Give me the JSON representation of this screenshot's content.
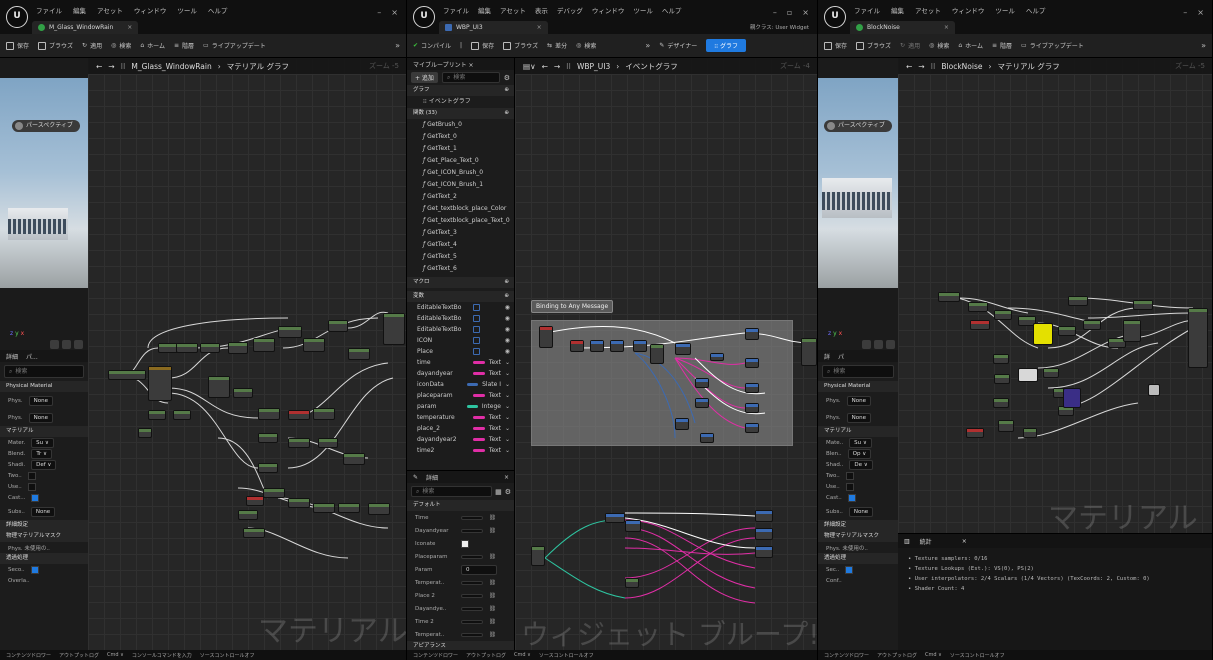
{
  "colors": {
    "accent": "#1f7ae0",
    "bp_blue": "#3c6ab2",
    "text_pink": "#e02ea6",
    "int_teal": "#2ec4a0",
    "exec_white": "#ffffff"
  },
  "win1": {
    "menus": [
      "ファイル",
      "編集",
      "アセット",
      "ウィンドウ",
      "ツール",
      "ヘルプ"
    ],
    "tab_title": "M_Glass_WindowRain",
    "toolbar": [
      "保存",
      "ブラウズ",
      "適用",
      "検索",
      "ホーム",
      "階層",
      "ライブアップデート"
    ],
    "perspective": "パースペクティブ",
    "breadcrumb_asset": "M_Glass_WindowRain",
    "breadcrumb_graph": "マテリアル グラフ",
    "zoom": "ズーム -5",
    "watermark": "マテリアル",
    "details_tabs": [
      "詳細",
      "パ..."
    ],
    "search_placeholder": "検索",
    "physical_material": "Physical Material",
    "phys_rows": [
      {
        "label": "Phys.",
        "value": "None"
      },
      {
        "label": "Phys.",
        "value": "None"
      }
    ],
    "material_section": "マテリアル",
    "mat_rows": [
      {
        "label": "Mater.",
        "value": "Su ∨"
      },
      {
        "label": "Blend.",
        "value": "Tr ∨"
      },
      {
        "label": "Shadi.",
        "value": "Def ∨"
      },
      {
        "label": "Two..",
        "value": ""
      },
      {
        "label": "Use..",
        "value": ""
      },
      {
        "label": "Cast...",
        "value": ""
      },
      {
        "label": "Subs..",
        "value": "None"
      }
    ],
    "sections_after": [
      "詳細設定",
      "物理マテリアルマスク",
      "Phys.  未使用の..",
      "透過処理"
    ],
    "lower_rows": [
      "Seco..",
      "Overla.."
    ],
    "bottom": [
      "コンテンツドロワー",
      "アウトプットログ",
      "Cmd ∨",
      "コンソールコマンドを入力",
      "ソースコントロールオフ"
    ]
  },
  "win2": {
    "menus": [
      "ファイル",
      "編集",
      "アセット",
      "表示",
      "デバッグ",
      "ウィンドウ",
      "ツール",
      "ヘルプ"
    ],
    "tab_title": "WBP_UI3",
    "parent_class": "親クラス: User Widget",
    "toolbar": [
      "コンパイル",
      "保存",
      "ブラウズ",
      "差分",
      "検索"
    ],
    "designer": "デザイナー",
    "graph": "グラフ",
    "my_blueprint": "マイブループリント ×",
    "add_button": "+ 追加",
    "search_placeholder": "検索",
    "graphs_section": "グラフ",
    "event_graph": "イベントグラフ",
    "functions_section": "関数 (33)",
    "functions": [
      "GetBrush_0",
      "GetText_0",
      "GetText_1",
      "Get_Place_Text_0",
      "Get_ICON_Brush_0",
      "Get_ICON_Brush_1",
      "GetText_2",
      "Get_textblock_place_Color",
      "Get_textblock_place_Text_0",
      "GetText_3",
      "GetText_4",
      "GetText_5",
      "GetText_6"
    ],
    "macros_section": "マクロ",
    "variables_section": "変数",
    "variables": [
      {
        "name": "EditableTextBo",
        "type": "",
        "kind": "widget"
      },
      {
        "name": "EditableTextBo",
        "type": "",
        "kind": "widget"
      },
      {
        "name": "EditableTextBo",
        "type": "",
        "kind": "widget"
      },
      {
        "name": "ICON",
        "type": "",
        "kind": "widget"
      },
      {
        "name": "Place",
        "type": "",
        "kind": "widget"
      },
      {
        "name": "time",
        "type": "Text",
        "kind": "text"
      },
      {
        "name": "dayandyear",
        "type": "Text",
        "kind": "text"
      },
      {
        "name": "iconData",
        "type": "Slate I",
        "kind": "struct"
      },
      {
        "name": "placeparam",
        "type": "Text",
        "kind": "text"
      },
      {
        "name": "param",
        "type": "Intege",
        "kind": "int"
      },
      {
        "name": "temperature",
        "type": "Text",
        "kind": "text"
      },
      {
        "name": "place_2",
        "type": "Text",
        "kind": "text"
      },
      {
        "name": "dayandyear2",
        "type": "Text",
        "kind": "text"
      },
      {
        "name": "time2",
        "type": "Text",
        "kind": "text"
      }
    ],
    "details_tab": "詳細",
    "details_search": "検索",
    "default_section": "デフォルト",
    "detail_rows": [
      "Time",
      "Dayandyear",
      "Iconate",
      "Placeparam",
      "Param",
      "Temperat..",
      "Place 2",
      "Dayandye..",
      "Time 2",
      "Temperat.."
    ],
    "param_value": "0",
    "appearance_section": "アピアランス",
    "breadcrumb_asset": "WBP_UI3",
    "breadcrumb_graph": "イベントグラフ",
    "zoom": "ズーム -4",
    "tooltip": "Binding to Any Message",
    "watermark": "ウィジェット ブループ!",
    "bottom": [
      "コンテンツドロワー",
      "アウトプットログ",
      "Cmd ∨",
      "ソースコントロールオフ"
    ]
  },
  "win3": {
    "menus": [
      "ファイル",
      "編集",
      "アセット",
      "ウィンドウ",
      "ツール",
      "ヘルプ"
    ],
    "tab_title": "BlockNoise",
    "toolbar": [
      "保存",
      "ブラウズ",
      "適用",
      "検索",
      "ホーム",
      "階層",
      "ライブアップデート"
    ],
    "perspective": "パースペクティブ",
    "breadcrumb_asset": "BlockNoise",
    "breadcrumb_graph": "マテリアル グラフ",
    "zoom": "ズーム -5",
    "watermark": "マテリアル",
    "details_tabs": [
      "詳",
      "パ"
    ],
    "search_placeholder": "検索",
    "physical_material": "Physical Material",
    "phys_rows": [
      {
        "label": "Phys.",
        "value": "None"
      },
      {
        "label": "Phys.",
        "value": "None"
      }
    ],
    "material_section": "マテリアル",
    "mat_rows": [
      {
        "label": "Mate..",
        "value": "Su ∨"
      },
      {
        "label": "Blen..",
        "value": "Op ∨"
      },
      {
        "label": "Shad..",
        "value": "De ∨"
      },
      {
        "label": "Two..",
        "value": ""
      },
      {
        "label": "Use..",
        "value": ""
      },
      {
        "label": "Cast..",
        "value": ""
      },
      {
        "label": "Subs..",
        "value": "None"
      }
    ],
    "sections_after": [
      "詳細設定",
      "物理マテリアルマスク",
      "Phys.  未使用の..",
      "透過処理"
    ],
    "lower_rows": [
      "Sec..",
      "Conf.."
    ],
    "stats_tab": "統計",
    "stats": [
      "• Texture samplers: 0/16",
      "• Texture Lookups (Est.): VS(0), PS(2)",
      "• User interpolators: 2/4 Scalars (1/4 Vectors) (TexCoords: 2, Custom: 0)",
      "• Shader Count: 4"
    ],
    "bottom": [
      "コンテンツドロワー",
      "アウトプットログ",
      "Cmd ∨",
      "ソースコントロールオフ"
    ]
  }
}
